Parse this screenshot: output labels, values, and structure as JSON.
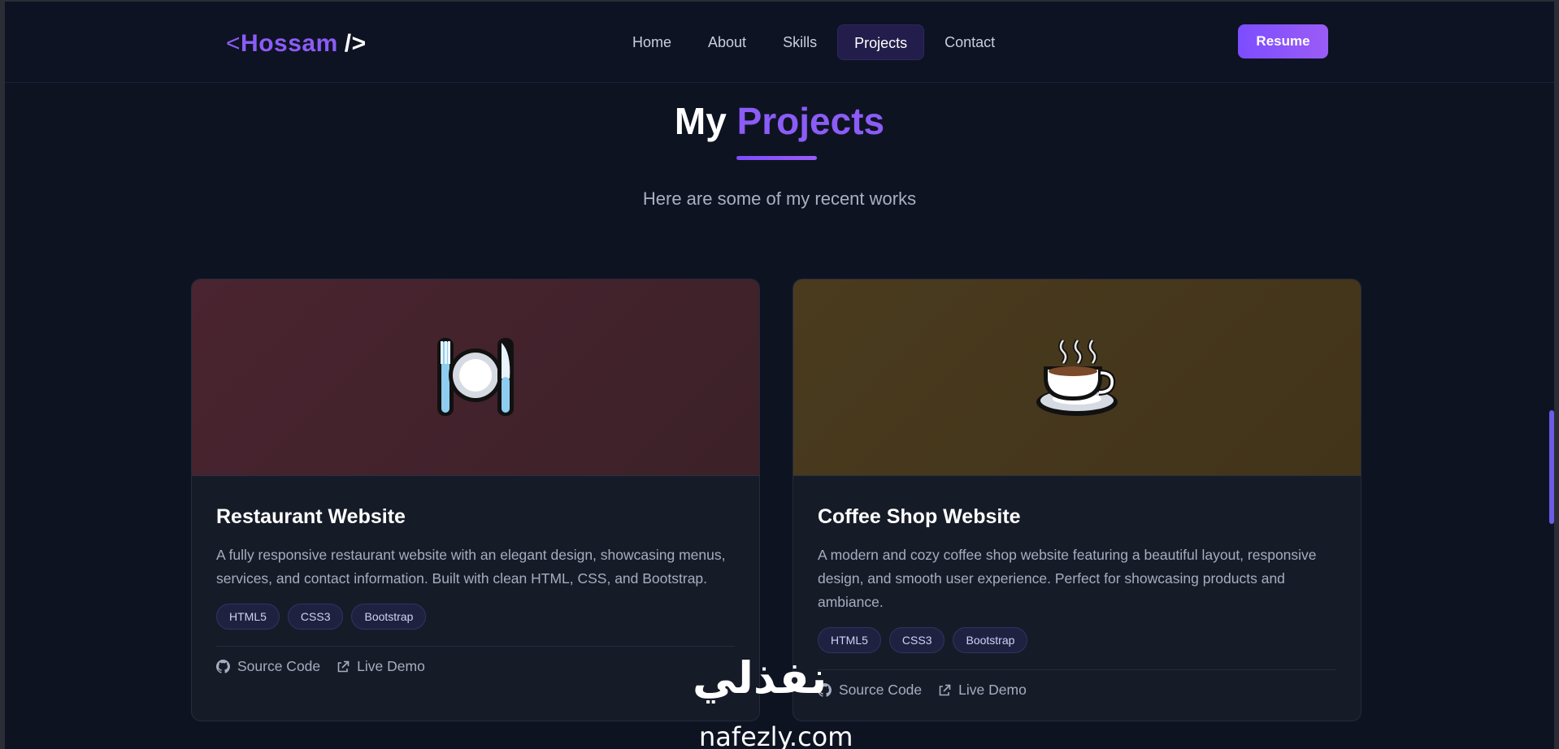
{
  "nav": {
    "logo": {
      "open": "<",
      "name": "Hossam",
      "close": "/>"
    },
    "items": [
      {
        "label": "Home"
      },
      {
        "label": "About"
      },
      {
        "label": "Skills"
      },
      {
        "label": "Projects",
        "active": true
      },
      {
        "label": "Contact"
      }
    ],
    "resume_label": "Resume"
  },
  "hero": {
    "title_part1": "My",
    "title_part2": "Projects",
    "subtitle": "Here are some of my recent works"
  },
  "projects": [
    {
      "icon": "plate-fork-knife-icon",
      "title": "Restaurant Website",
      "description": "A fully responsive restaurant website with an elegant design, showcasing menus, services, and contact information. Built with clean HTML, CSS, and Bootstrap.",
      "tags": [
        "HTML5",
        "CSS3",
        "Bootstrap"
      ],
      "source_label": "Source Code",
      "demo_label": "Live Demo"
    },
    {
      "icon": "hot-coffee-icon",
      "title": "Coffee Shop Website",
      "description": "A modern and cozy coffee shop website featuring a beautiful layout, responsive design, and smooth user experience. Perfect for showcasing products and ambiance.",
      "tags": [
        "HTML5",
        "CSS3",
        "Bootstrap"
      ],
      "source_label": "Source Code",
      "demo_label": "Live Demo"
    }
  ],
  "watermark": {
    "arabic": "نفذلي",
    "latin": "nafezly.com"
  },
  "colors": {
    "accent": "#8b5cf6",
    "background": "#0e1322",
    "card": "#161b28"
  }
}
